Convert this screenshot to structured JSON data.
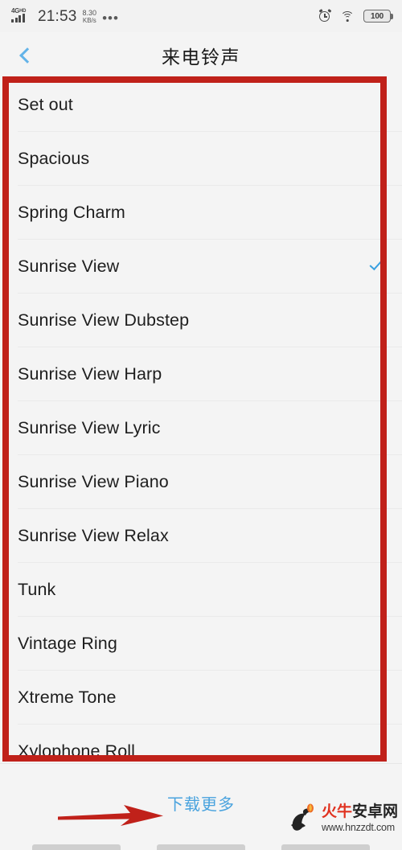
{
  "statusbar": {
    "network_type": "4G",
    "network_suffix": "HD",
    "time": "21:53",
    "net_speed_value": "8.30",
    "net_speed_unit": "KB/s",
    "overflow": "•••",
    "battery_level": "100",
    "icons": [
      "signal-icon",
      "alarm-icon",
      "wifi-icon",
      "battery-icon"
    ]
  },
  "header": {
    "title": "来电铃声",
    "back_label": "back"
  },
  "list": {
    "items": [
      {
        "label": "Set out",
        "selected": false
      },
      {
        "label": "Spacious",
        "selected": false
      },
      {
        "label": "Spring Charm",
        "selected": false
      },
      {
        "label": "Sunrise View",
        "selected": true
      },
      {
        "label": "Sunrise View Dubstep",
        "selected": false
      },
      {
        "label": "Sunrise View Harp",
        "selected": false
      },
      {
        "label": "Sunrise View Lyric",
        "selected": false
      },
      {
        "label": "Sunrise View Piano",
        "selected": false
      },
      {
        "label": "Sunrise View Relax",
        "selected": false
      },
      {
        "label": "Tunk",
        "selected": false
      },
      {
        "label": "Vintage Ring",
        "selected": false
      },
      {
        "label": "Xtreme Tone",
        "selected": false
      },
      {
        "label": "Xylophone Roll",
        "selected": false
      }
    ]
  },
  "footer": {
    "download_more": "下载更多"
  },
  "annotations": {
    "box_color": "#c0211a",
    "arrow_color": "#c0211a"
  },
  "watermark": {
    "name_red": "火牛",
    "name_black": "安卓网",
    "url": "www.hnzzdt.com"
  },
  "colors": {
    "accent_blue": "#4aa3de",
    "check_blue": "#3aa0e0",
    "background": "#f4f4f4",
    "text": "#1e1e1e",
    "annotation_red": "#c0211a"
  }
}
